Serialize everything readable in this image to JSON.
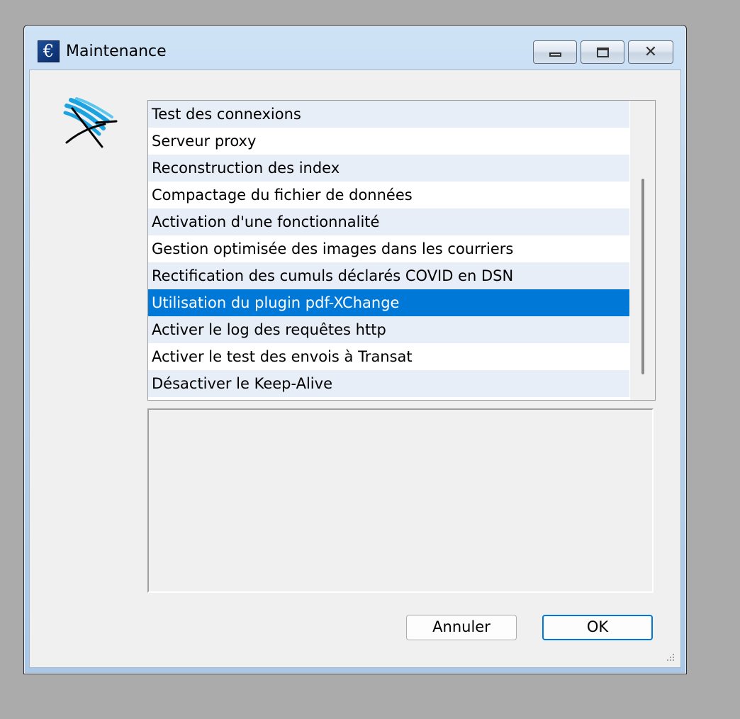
{
  "window": {
    "title": "Maintenance",
    "app_icon_glyph": "€",
    "app_icon_name": "euro-app-icon",
    "controls": {
      "minimize_icon": "minimize-icon",
      "maximize_icon": "maximize-icon",
      "close_icon": "close-icon",
      "close_glyph": "✕"
    }
  },
  "logo": {
    "icon_name": "deckchair-logo-icon"
  },
  "list": {
    "items": [
      {
        "label": "Test des connexions"
      },
      {
        "label": "Serveur proxy"
      },
      {
        "label": "Reconstruction des index"
      },
      {
        "label": "Compactage du fichier de données"
      },
      {
        "label": "Activation d'une fonctionnalité"
      },
      {
        "label": "Gestion optimisée des images dans les courriers"
      },
      {
        "label": "Rectification des cumuls déclarés COVID en DSN"
      },
      {
        "label": "Utilisation du plugin pdf-XChange"
      },
      {
        "label": "Activer le log des requêtes http"
      },
      {
        "label": "Activer le test des envois à Transat"
      },
      {
        "label": "Désactiver le Keep-Alive"
      }
    ],
    "selected_index": 7
  },
  "description": {
    "text": ""
  },
  "buttons": {
    "cancel_label": "Annuler",
    "ok_label": "OK"
  },
  "colors": {
    "selection": "#0078d7",
    "alt_row": "#e8eef8",
    "desktop": "#ababab"
  }
}
